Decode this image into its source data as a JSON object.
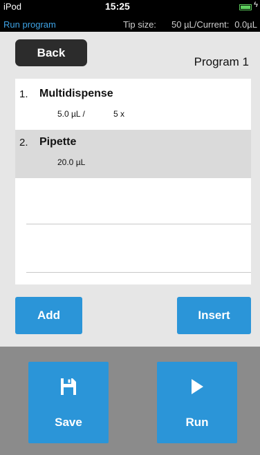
{
  "status_bar": {
    "carrier": "iPod",
    "time": "15:25",
    "app_name": "Run program",
    "tip_size_label": "Tip size:",
    "current_label": "50 µL/Current:",
    "current_value": "0.0µL",
    "battery_level": 1.0,
    "battery_color": "#5ed05e",
    "charge_icon": "bolt-icon"
  },
  "header": {
    "back_label": "Back",
    "program_title": "Program 1"
  },
  "steps": [
    {
      "number": "1.",
      "name": "Multidispense",
      "volume": "5.0 µL /",
      "count": "5 x"
    },
    {
      "number": "2.",
      "name": "Pipette",
      "volume": "20.0 µL"
    }
  ],
  "actions": {
    "add_label": "Add",
    "insert_label": "Insert"
  },
  "footer": {
    "save_label": "Save",
    "save_icon": "floppy-disk-icon",
    "run_label": "Run",
    "run_icon": "play-icon"
  },
  "colors": {
    "accent": "#2b95d8",
    "status_app": "#3ea3e6",
    "back_button": "#2c2c2c",
    "selected_row": "#dadada"
  }
}
